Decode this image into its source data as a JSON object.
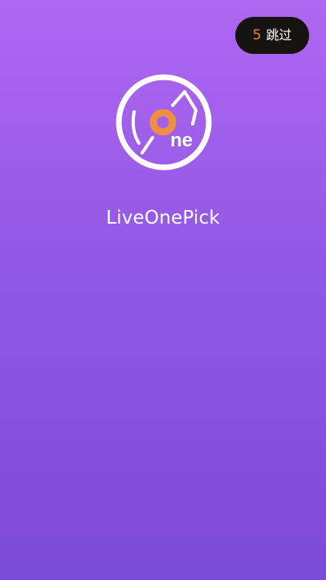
{
  "skip": {
    "countdown": "5",
    "label": "跳过"
  },
  "logo": {
    "icon": "liveonepick-logo-icon",
    "text": "ne"
  },
  "app": {
    "name": "LiveOnePick"
  },
  "colors": {
    "background_top": "#b067f2",
    "background_bottom": "#7a4bd8",
    "skip_background": "#161412",
    "countdown": "#f0861f",
    "logo_ring": "#ffffff",
    "logo_accent": "#ee8f43"
  }
}
